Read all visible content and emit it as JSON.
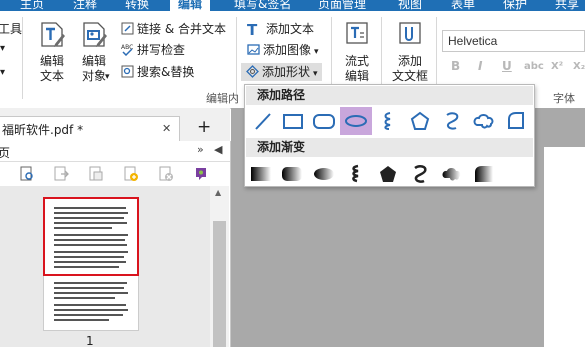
{
  "tabs": [
    "主页",
    "注释",
    "转换",
    "编辑",
    "填写&签名",
    "页面管理",
    "视图",
    "表单",
    "保护",
    "共享"
  ],
  "active_tab": "编辑",
  "ribbon": {
    "left_cut": [
      "工具"
    ],
    "edit_text": "编辑\n文本",
    "edit_object": "编辑\n对象",
    "link_merge": "链接 & 合并文本",
    "spell_check": "拼写检查",
    "search_replace": "搜索&替换",
    "add_text": "添加文本",
    "add_image": "添加图像",
    "add_shape": "添加形状",
    "flow_edit": "流式\n编辑",
    "add_textbox": "添加\n文文框",
    "group_edit": "编辑内",
    "group_font": "字体",
    "font_name": "Helvetica",
    "format_buttons": [
      "B",
      "I",
      "U",
      "abc",
      "X²",
      "X₂"
    ]
  },
  "document_tab": {
    "title": "福昕软件.pdf *",
    "add_tab": "+"
  },
  "panel": {
    "header_left": "页",
    "page_number": "1"
  },
  "dropdown": {
    "section_path": "添加路径",
    "section_gradient": "添加渐变",
    "path_shapes": [
      "line-icon",
      "rectangle-icon",
      "rounded-rect-icon",
      "ellipse-icon",
      "squiggle-icon",
      "pentagon-icon",
      "s-curve-icon",
      "cloud-icon",
      "corner-shape-icon"
    ],
    "selected_shape": "ellipse-icon",
    "gradient_shapes": [
      "gradient-rect-icon",
      "gradient-rounded-icon",
      "gradient-ellipse-icon",
      "gradient-squiggle-icon",
      "gradient-pentagon-icon",
      "gradient-s-curve-icon",
      "gradient-cloud-icon",
      "gradient-corner-icon"
    ]
  },
  "colors": {
    "tabbar": "#1f6fb5",
    "accent_blue": "#2b6cb5",
    "selected": "#c9a7dc",
    "highlight_border": "#d9141e",
    "canvas": "#a9a9a9"
  }
}
